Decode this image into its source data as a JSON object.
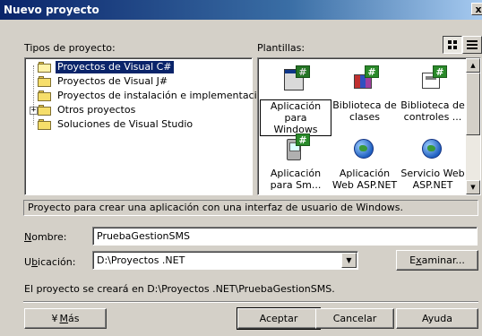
{
  "window": {
    "title": "Nuevo proyecto",
    "close_label": "x"
  },
  "labels": {
    "project_types": "Tipos de proyecto:",
    "templates": "Plantillas:"
  },
  "project_types": [
    {
      "label": "Proyectos de Visual C#",
      "selected": true,
      "open": true
    },
    {
      "label": "Proyectos de Visual J#",
      "selected": false
    },
    {
      "label": "Proyectos de instalación e implementación",
      "selected": false
    },
    {
      "label": "Otros proyectos",
      "selected": false,
      "expandable": true,
      "expander": "+"
    },
    {
      "label": "Soluciones de Visual Studio",
      "selected": false
    }
  ],
  "templates": [
    {
      "label_line1": "Aplicación",
      "label_line2": "para Windows",
      "icon": "windows-app-icon",
      "selected": true,
      "badge": "#"
    },
    {
      "label_line1": "Biblioteca de",
      "label_line2": "clases",
      "icon": "class-library-icon",
      "selected": false,
      "badge": "#"
    },
    {
      "label_line1": "Biblioteca de",
      "label_line2": "controles ...",
      "icon": "control-library-icon",
      "selected": false,
      "badge": "#"
    },
    {
      "label_line1": "Aplicación",
      "label_line2": "para Sm...",
      "icon": "smart-device-app-icon",
      "selected": false,
      "badge": "#"
    },
    {
      "label_line1": "Aplicación",
      "label_line2": "Web ASP.NET",
      "icon": "asp-web-app-icon",
      "selected": false
    },
    {
      "label_line1": "Servicio Web",
      "label_line2": "ASP.NET",
      "icon": "asp-web-service-icon",
      "selected": false
    }
  ],
  "view_buttons": {
    "large_icons": "large-icons-view-icon",
    "small_icons": "list-view-icon"
  },
  "description": "Proyecto para crear una aplicación con una interfaz de usuario de Windows.",
  "form": {
    "name_label": "Nombre:",
    "name_value": "PruebaGestionSMS",
    "location_label": "Ubicación:",
    "location_value": "D:\\Proyectos .NET",
    "browse_label": "Examinar...",
    "result_text": "El proyecto se creará en D:\\Proyectos .NET\\PruebaGestionSMS."
  },
  "buttons": {
    "more": "Más",
    "more_arrows": "¥",
    "accept": "Aceptar",
    "cancel": "Cancelar",
    "help": "Ayuda"
  }
}
